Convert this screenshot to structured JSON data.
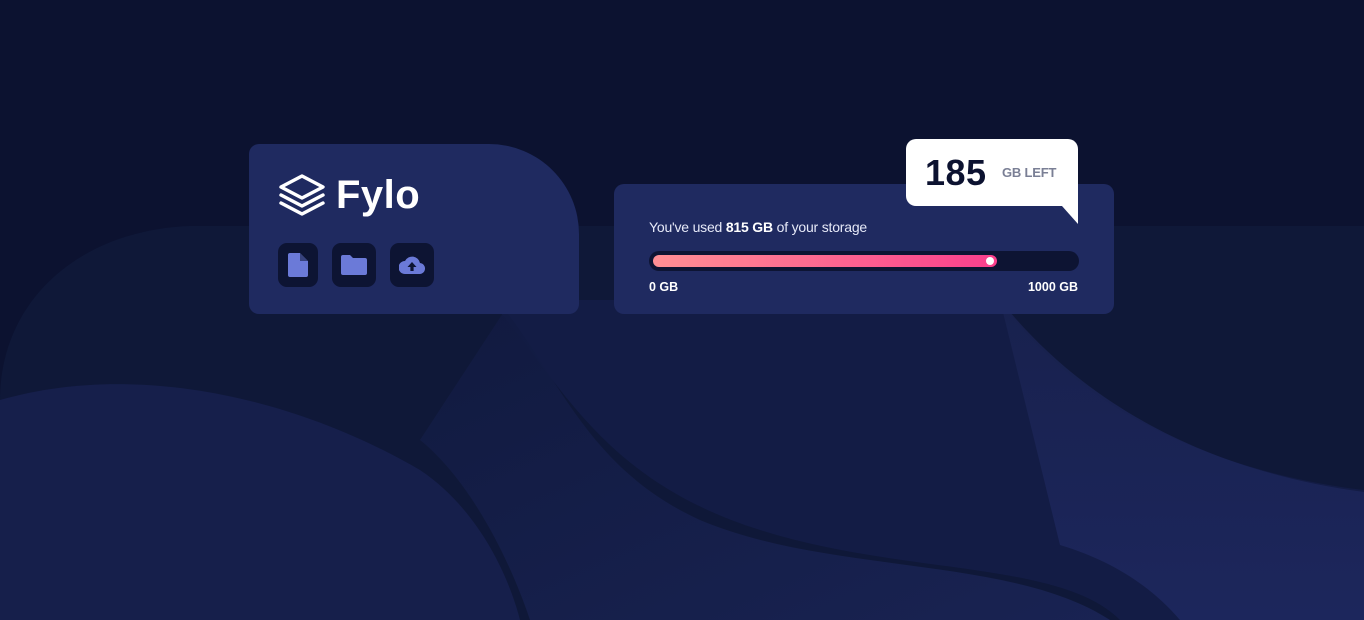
{
  "brand": {
    "name": "Fylo",
    "logo_icon": "layers-logo"
  },
  "actions": [
    {
      "icon": "document-icon"
    },
    {
      "icon": "folder-icon"
    },
    {
      "icon": "cloud-upload-icon"
    }
  ],
  "storage": {
    "used_prefix": "You've used",
    "used_amount": "815 GB",
    "used_suffix": "of your storage",
    "used_fraction": 0.815,
    "scale_min": "0 GB",
    "scale_max": "1000 GB",
    "remaining_value": "185",
    "remaining_label": "GB LEFT"
  },
  "colors": {
    "page_background": "#0c1230",
    "card_background": "#1f2a60",
    "icon_tile": "#0d1433",
    "icon_accent": "#6b7ad8",
    "bar_gradient_start": "#ff8f94",
    "bar_gradient_end": "#fa3f8d"
  }
}
